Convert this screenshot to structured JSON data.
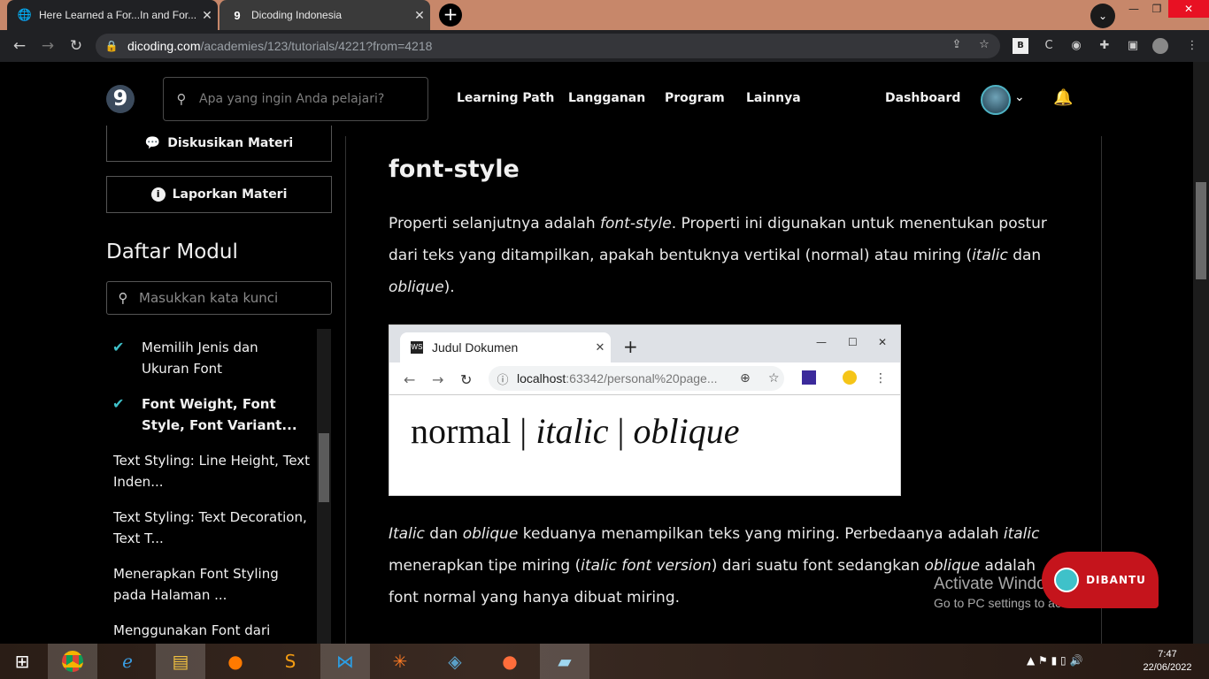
{
  "browser": {
    "tabs": [
      {
        "title": "Here Learned a For...In and For...c",
        "favicon": "globe-icon"
      },
      {
        "title": "Dicoding Indonesia",
        "favicon": "dicoding-favicon"
      }
    ],
    "new_tab": "+",
    "url_domain": "dicoding.com",
    "url_path": "/academies/123/tutorials/4221?from=4218"
  },
  "header": {
    "logo": "9",
    "search_placeholder": "Apa yang ingin Anda pelajari?",
    "nav": [
      "Learning Path",
      "Langganan",
      "Program",
      "Lainnya"
    ],
    "dashboard": "Dashboard"
  },
  "sidebar": {
    "discuss_label": "Diskusikan Materi",
    "report_label": "Laporkan Materi",
    "modules_title": "Daftar Modul",
    "module_search_placeholder": "Masukkan kata kunci",
    "modules": [
      {
        "label": "Memilih Jenis dan Ukuran Font",
        "done": true
      },
      {
        "label": "Font Weight, Font Style, Font Variant...",
        "done": true,
        "current": true
      },
      {
        "label": "Text Styling: Line Height, Text Inden...",
        "done": false
      },
      {
        "label": "Text Styling: Text Decoration, Text T...",
        "done": false
      },
      {
        "label": "Menerapkan Font Styling pada Halaman ...",
        "done": false
      },
      {
        "label": "Menggunakan Font dari",
        "done": false
      }
    ]
  },
  "article": {
    "heading": "font-style",
    "p1_a": "Properti selanjutnya adalah ",
    "p1_b": "font-style",
    "p1_c": ". Properti ini digunakan untuk menentukan postur dari teks yang ditampilkan, apakah bentuknya vertikal (normal) atau miring (",
    "p1_d": "italic",
    "p1_e": " dan ",
    "p1_f": "oblique",
    "p1_g": ").",
    "p2_a": "Italic",
    "p2_b": " dan ",
    "p2_c": "oblique",
    "p2_d": " keduanya menampilkan teks yang miring. Perbedaanya adalah ",
    "p2_e": "italic",
    "p2_f": " menerapkan tipe miring (",
    "p2_g": "italic font version",
    "p2_h": ") dari suatu font sedangkan ",
    "p2_i": "oblique",
    "p2_j": " adalah font normal yang hanya dibuat miring."
  },
  "embedded": {
    "tab_title": "Judul Dokumen",
    "url_host": "localhost",
    "url_rest": ":63342/personal%20page...",
    "sample_normal": "normal | ",
    "sample_italic": "italic",
    "sample_sep": " | ",
    "sample_oblique": "oblique"
  },
  "help_button": "DIBANTU",
  "watermark": {
    "line1": "Activate Windows",
    "line2": "Go to PC settings to activate Windows."
  },
  "taskbar": {
    "time": "7:47",
    "date": "22/06/2022"
  },
  "colors": {
    "accent": "#3fc1c9",
    "help_red": "#c5141c",
    "tab_strip": "#c7876a"
  }
}
